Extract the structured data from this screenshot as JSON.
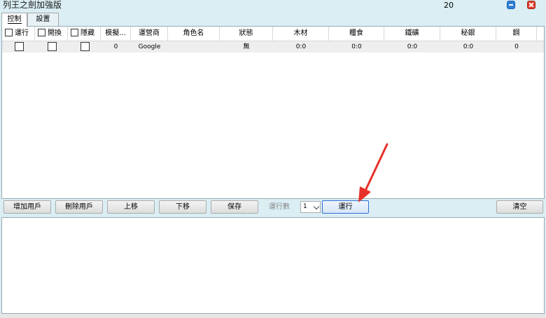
{
  "window": {
    "title": "列王之劍加強版",
    "count": "20"
  },
  "tabs": [
    {
      "label": "控制"
    },
    {
      "label": "設置"
    }
  ],
  "table": {
    "columns": [
      "運行",
      "開換",
      "隱藏",
      "模擬...",
      "運營商",
      "角色名",
      "狀態",
      "木材",
      "糧食",
      "鐵礦",
      "秘銀",
      "鋼"
    ],
    "rows": [
      {
        "checks": [
          false,
          false,
          false
        ],
        "cells": [
          "0",
          "Google",
          "",
          "無",
          "0:0",
          "0:0",
          "0:0",
          "0:0",
          "0"
        ]
      }
    ]
  },
  "toolbar": {
    "add_user": "增加用戶",
    "remove_user": "刪除用戶",
    "move_up": "上移",
    "move_down": "下移",
    "save": "保存",
    "run_count_label": "運行數",
    "run_count_value": "1",
    "run": "運行",
    "clear": "清空"
  },
  "colors": {
    "background": "#daeef3",
    "annotation_arrow": "#e8302a",
    "focus_border": "#2f6fd6"
  }
}
